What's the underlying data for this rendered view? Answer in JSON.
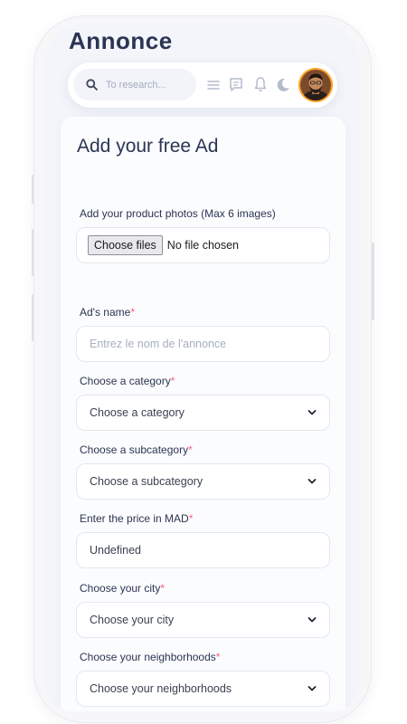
{
  "header": {
    "title": "Annonce",
    "search_placeholder": "To research..."
  },
  "icons": [
    "search-icon",
    "menu-icon",
    "message-icon",
    "bell-icon",
    "moon-icon",
    "avatar"
  ],
  "form": {
    "title": "Add your free Ad",
    "photos": {
      "label": "Add your product photos (Max 6 images)",
      "button": "Choose files",
      "status": "No file chosen"
    },
    "ad_name": {
      "label": "Ad's name",
      "required": "*",
      "placeholder": "Entrez le nom de l'annonce"
    },
    "category": {
      "label": "Choose a category",
      "required": "*",
      "value": "Choose a category"
    },
    "subcategory": {
      "label": "Choose a subcategory",
      "required": "*",
      "value": "Choose a subcategory"
    },
    "price": {
      "label": "Enter the price in MAD",
      "required": "*",
      "value": "Undefined"
    },
    "city": {
      "label": "Choose your city",
      "required": "*",
      "value": "Choose your city"
    },
    "neighborhood": {
      "label": "Choose your neighborhoods",
      "required": "*",
      "value": "Choose your neighborhoods"
    }
  },
  "colors": {
    "text": "#2b3553",
    "required": "#ff5c7c",
    "screen_bg": "#f3f5fa",
    "avatar_ring": "#ff9f1c"
  }
}
